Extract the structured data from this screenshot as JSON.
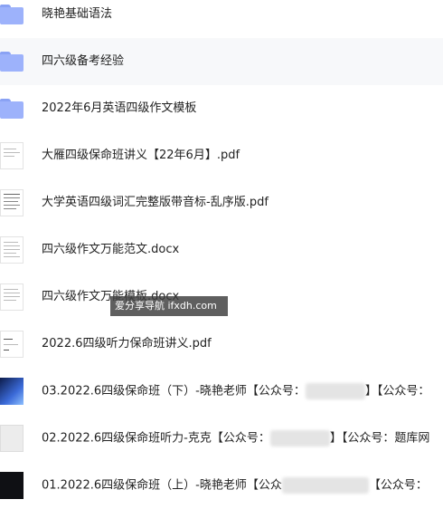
{
  "files": [
    {
      "name": "晓艳基础语法",
      "type": "folder"
    },
    {
      "name": "四六级备考经验",
      "type": "folder"
    },
    {
      "name": "2022年6月英语四级作文模板",
      "type": "folder"
    },
    {
      "name": "大雁四级保命班讲义【22年6月】.pdf",
      "type": "pdf"
    },
    {
      "name": "大学英语四级词汇完整版带音标-乱序版.pdf",
      "type": "pdf"
    },
    {
      "name": "四六级作文万能范文.docx",
      "type": "docx"
    },
    {
      "name": "四六级作文万能模板.docx",
      "type": "docx"
    },
    {
      "name": "2022.6四级听力保命班讲义.pdf",
      "type": "pdf"
    },
    {
      "name_prefix": "03.2022.6四级保命班（下）-晓艳老师【公众号：",
      "name_suffix": "】【公众号：",
      "type": "video"
    },
    {
      "name_prefix": "02.2022.6四级保命班听力-克克【公众号：",
      "name_suffix": "】【公众号：题库网",
      "type": "video"
    },
    {
      "name_prefix": "01.2022.6四级保命班（上）-晓艳老师【公众",
      "name_suffix": "【公众号：",
      "type": "video"
    }
  ],
  "watermark": "爱分享导航 ifxdh.com"
}
